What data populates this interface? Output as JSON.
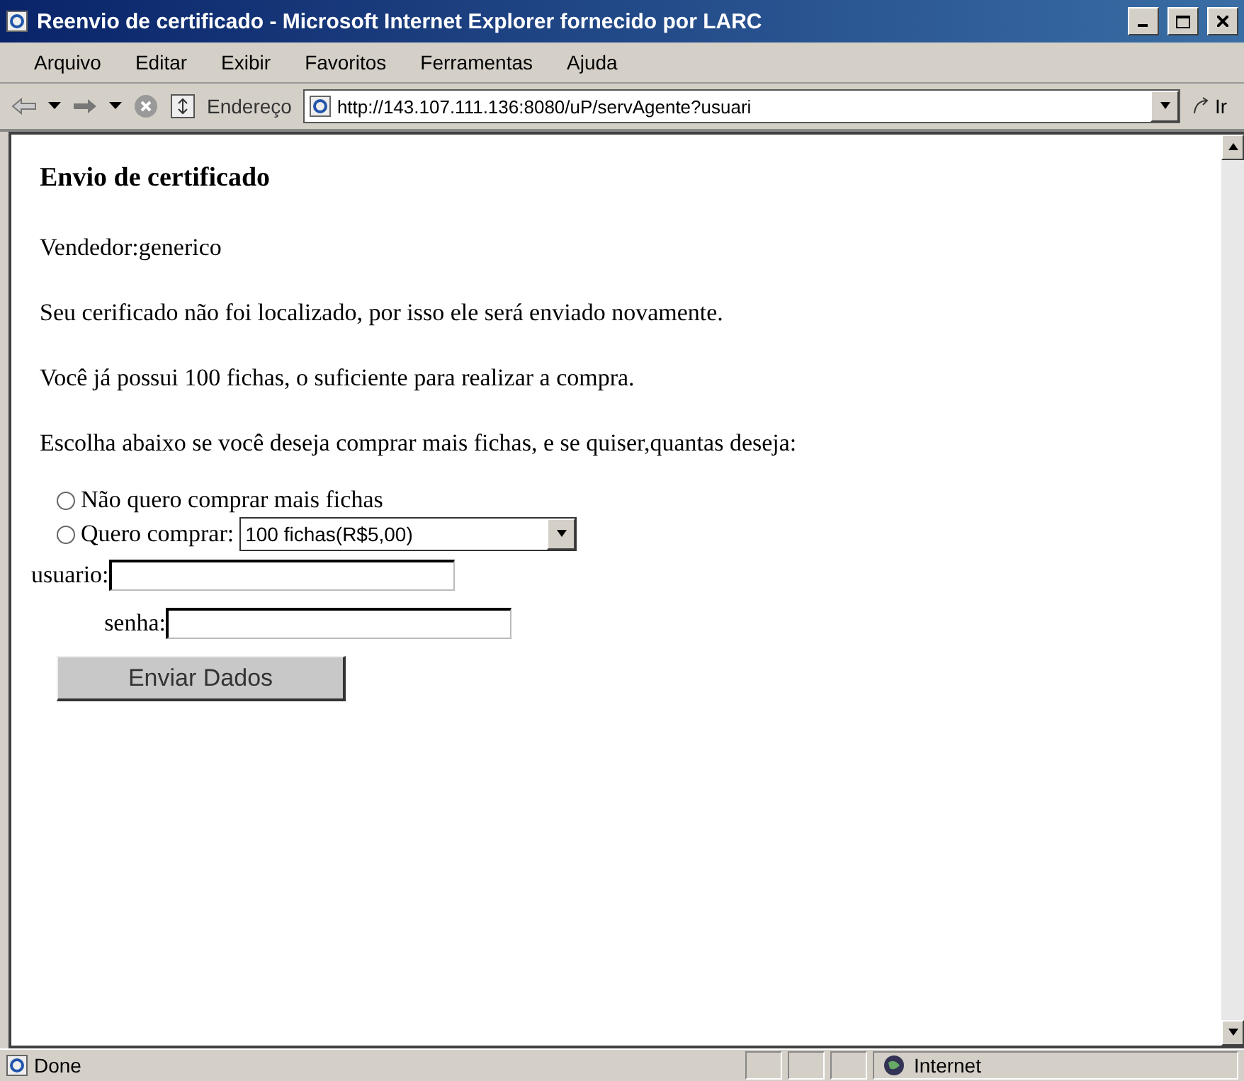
{
  "window": {
    "title": "Reenvio de certificado - Microsoft Internet Explorer fornecido por LARC"
  },
  "menu": [
    "Arquivo",
    "Editar",
    "Exibir",
    "Favoritos",
    "Ferramentas",
    "Ajuda"
  ],
  "address": {
    "label": "Endereço",
    "value": "http://143.107.111.136:8080/uP/servAgente?usuari",
    "go": "Ir"
  },
  "page": {
    "heading": "Envio de certificado",
    "paragraphs": [
      "Vendedor:generico",
      "Seu cerificado não foi localizado, por isso ele será enviado novamente.",
      "Você já possui 100 fichas, o suficiente para realizar a compra.",
      "Escolha abaixo se você deseja comprar mais fichas, e se quiser,quantas deseja:"
    ],
    "options": [
      {
        "label": "Não quero comprar mais fichas",
        "selected": false
      },
      {
        "label": "Quero comprar:",
        "selected": false,
        "select": "100 fichas(R$5,00)"
      }
    ],
    "fields": [
      {
        "label": "usuario:"
      },
      {
        "label": "senha:"
      }
    ],
    "submit": "Enviar Dados"
  },
  "status_bar": {
    "text": "Done",
    "zone": "Internet"
  }
}
